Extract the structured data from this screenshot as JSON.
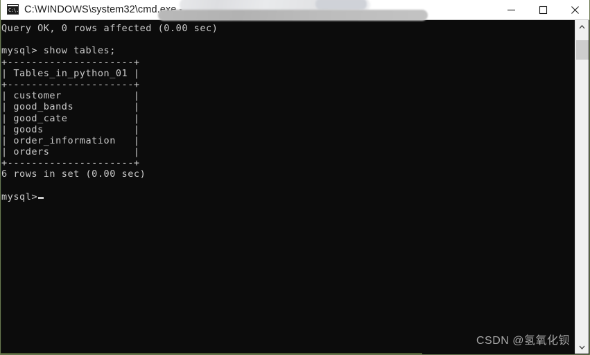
{
  "window": {
    "title": "C:\\WINDOWS\\system32\\cmd.exe - mysql",
    "icon": "cmd-console-icon",
    "icon_glyph": "C:\\.",
    "colors": {
      "titlebar_bg": "#ffffff",
      "titlebar_text": "#1a1a1a",
      "console_bg": "#0c0c0c",
      "console_text": "#cccccc",
      "scrollbar_track": "#f0f0f0",
      "scrollbar_thumb": "#cdcdcd",
      "window_border": "#6b7a52"
    },
    "controls": [
      {
        "name": "minimize",
        "label": "—"
      },
      {
        "name": "maximize",
        "label": "□"
      },
      {
        "name": "close",
        "label": "✕"
      }
    ]
  },
  "console": {
    "lines": [
      "Query OK, 0 rows affected (0.00 sec)",
      "",
      "mysql> show tables;",
      "+---------------------+",
      "| Tables_in_python_01 |",
      "+---------------------+",
      "| customer            |",
      "| good_bands          |",
      "| good_cate           |",
      "| goods               |",
      "| order_information   |",
      "| orders              |",
      "+---------------------+",
      "6 rows in set (0.00 sec)",
      "",
      "mysql>"
    ],
    "prompt": "mysql>",
    "cursor_visible": true,
    "result_table": {
      "header": "Tables_in_python_01",
      "rows": [
        "customer",
        "good_bands",
        "good_cate",
        "goods",
        "order_information",
        "orders"
      ],
      "row_count_text": "6 rows in set (0.00 sec)",
      "separator": "+---------------------+"
    },
    "commands": [
      "show tables;"
    ],
    "status_messages": [
      "Query OK, 0 rows affected (0.00 sec)",
      "6 rows in set (0.00 sec)"
    ]
  },
  "scrollbar": {
    "up_arrow": "chevron-up",
    "down_arrow": "chevron-down",
    "thumb_position_pct": 6,
    "thumb_size_pct": 6
  },
  "watermark": {
    "text": "CSDN @氢氧化钡"
  }
}
